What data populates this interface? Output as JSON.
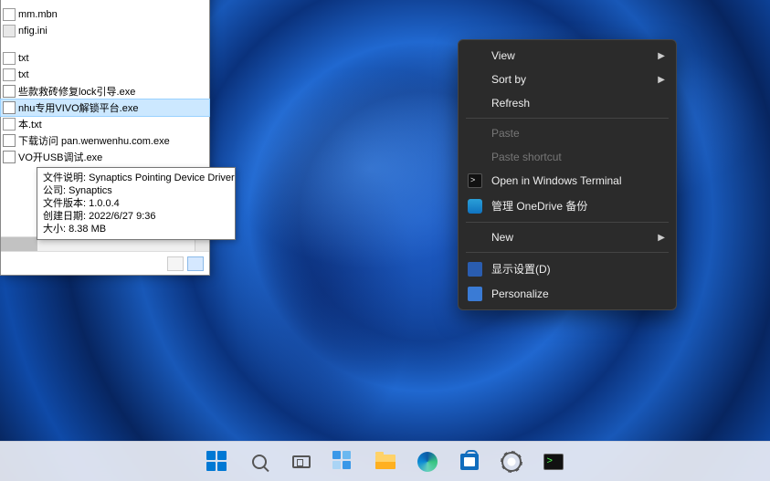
{
  "explorer": {
    "files": [
      {
        "name": "mm.mbn",
        "type": "mbn"
      },
      {
        "name": "nfig.ini",
        "type": "ini"
      },
      {
        "name": "",
        "type": "gap"
      },
      {
        "name": "txt",
        "type": "txt"
      },
      {
        "name": "txt",
        "type": "txt"
      },
      {
        "name": "些款救砖修复lock引导.exe",
        "type": "exe"
      },
      {
        "name": "nhu专用VIVO解锁平台.exe",
        "type": "exe",
        "selected": true
      },
      {
        "name": "本.txt",
        "type": "txt"
      },
      {
        "name": "下载访问 pan.wenwenhu.com.exe",
        "type": "exe"
      },
      {
        "name": "VO开USB调试.exe",
        "type": "exe"
      }
    ]
  },
  "tooltip": {
    "line1": "文件说明: Synaptics Pointing Device Driver",
    "line2": "公司: Synaptics",
    "line3": "文件版本: 1.0.0.4",
    "line4": "创建日期: 2022/6/27 9:36",
    "line5": "大小: 8.38 MB"
  },
  "context_menu": {
    "view": "View",
    "sort_by": "Sort by",
    "refresh": "Refresh",
    "paste": "Paste",
    "paste_shortcut": "Paste shortcut",
    "open_terminal": "Open in Windows Terminal",
    "onedrive": "管理 OneDrive 备份",
    "new": "New",
    "display_settings": "显示设置(D)",
    "personalize": "Personalize"
  },
  "taskbar": {
    "items": [
      "start",
      "search",
      "taskview",
      "widgets",
      "explorer",
      "edge",
      "store",
      "settings",
      "terminal"
    ]
  }
}
